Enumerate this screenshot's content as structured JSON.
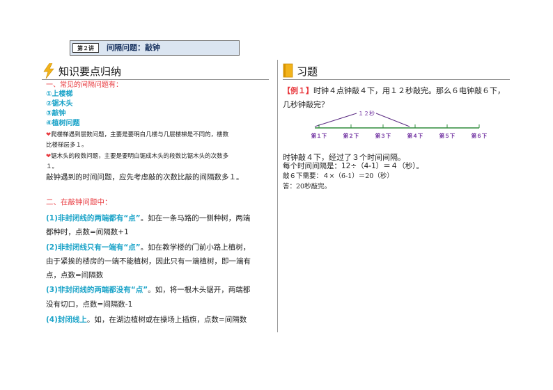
{
  "header": {
    "lesson": "第２讲",
    "topic": "间隔问题：敲钟"
  },
  "left": {
    "title": "知识要点归纳",
    "intro_heading": "一、常见的间隔问题有：",
    "types": [
      "①上楼梯",
      "②锯木头",
      "③敲钟",
      "④植树问题"
    ],
    "note1_line1": "爬楼梯遇到层数问题，主要是要明白几楼与几层楼梯是不同的，楼数",
    "note1_line2": "比楼梯层多１。",
    "note2_line1": "锯木头的段数问题，主要是要明白锯成木头的段数比锯木头的次数多",
    "note2_line2": "１。",
    "note3": "敲钟遇到的时间问题，应先考虑敲的次数比敲的间隔数多１。",
    "bell_heading": "二、在敲钟问题中：",
    "case1_label": "(1)非封闭线的两端都有“点”",
    "case1_text": "。如在一条马路的一侧种树，两端",
    "case1_line2": "都种时，点数=间隔数+1",
    "case2_label": "(2)非封闭线只有一端有“点”",
    "case2_text": "。如在教学楼的门前小路上植树，",
    "case2_line2": "由于紧挨的楼房的一端不能植树，因此只有一端植树，即一端有",
    "case2_line3": "点，点数=间隔数",
    "case3_label": "(3)非封闭线的两端都没有“点”",
    "case3_text": "。如，将一根木头锯开，两端都",
    "case3_line2": "没有切口，点数=间隔数-1",
    "case4_label": "(4)封闭线上",
    "case4_text": "。如，在湖边植树或在操场上插旗，点数=间隔数"
  },
  "right": {
    "title": "习题",
    "example_label": "【例１】",
    "question_line1": "时钟４点钟敲４下，用１２秒敲完。那么６电钟敲６下，",
    "question_line2": "几秒钟敲完？",
    "diagram": {
      "span_label": "１２秒",
      "ticks": [
        "第１下",
        "第２下",
        "第３下",
        "第４下",
        "第５下",
        "第６下"
      ]
    },
    "solution": [
      "时钟敲４下，经过了３个时间间隔。",
      "每个时间间隔是：12÷（4-1）＝４（秒）。",
      "敲６下需要：４×（6-1）＝20（秒）",
      "答：20秒敲完。"
    ]
  }
}
